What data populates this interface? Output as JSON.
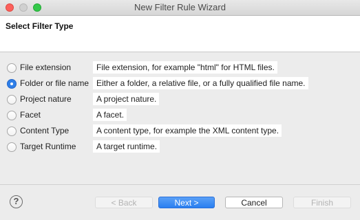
{
  "window": {
    "title": "New Filter Rule Wizard"
  },
  "header": {
    "title": "Select Filter Type"
  },
  "options": [
    {
      "label": "File extension",
      "description": "File extension, for example \"html\" for HTML files.",
      "selected": false
    },
    {
      "label": "Folder or file name",
      "description": "Either a folder, a relative file, or a fully qualified file name.",
      "selected": true
    },
    {
      "label": "Project nature",
      "description": "A project nature.",
      "selected": false
    },
    {
      "label": "Facet",
      "description": "A facet.",
      "selected": false
    },
    {
      "label": "Content Type",
      "description": "A content type, for example the XML content type.",
      "selected": false
    },
    {
      "label": "Target Runtime",
      "description": "A target runtime.",
      "selected": false
    }
  ],
  "footer": {
    "help_icon": "?",
    "back_label": "< Back",
    "next_label": "Next >",
    "cancel_label": "Cancel",
    "finish_label": "Finish"
  },
  "colors": {
    "accent": "#2f7fe8",
    "close": "#fc605c",
    "maximize": "#34c84a"
  }
}
